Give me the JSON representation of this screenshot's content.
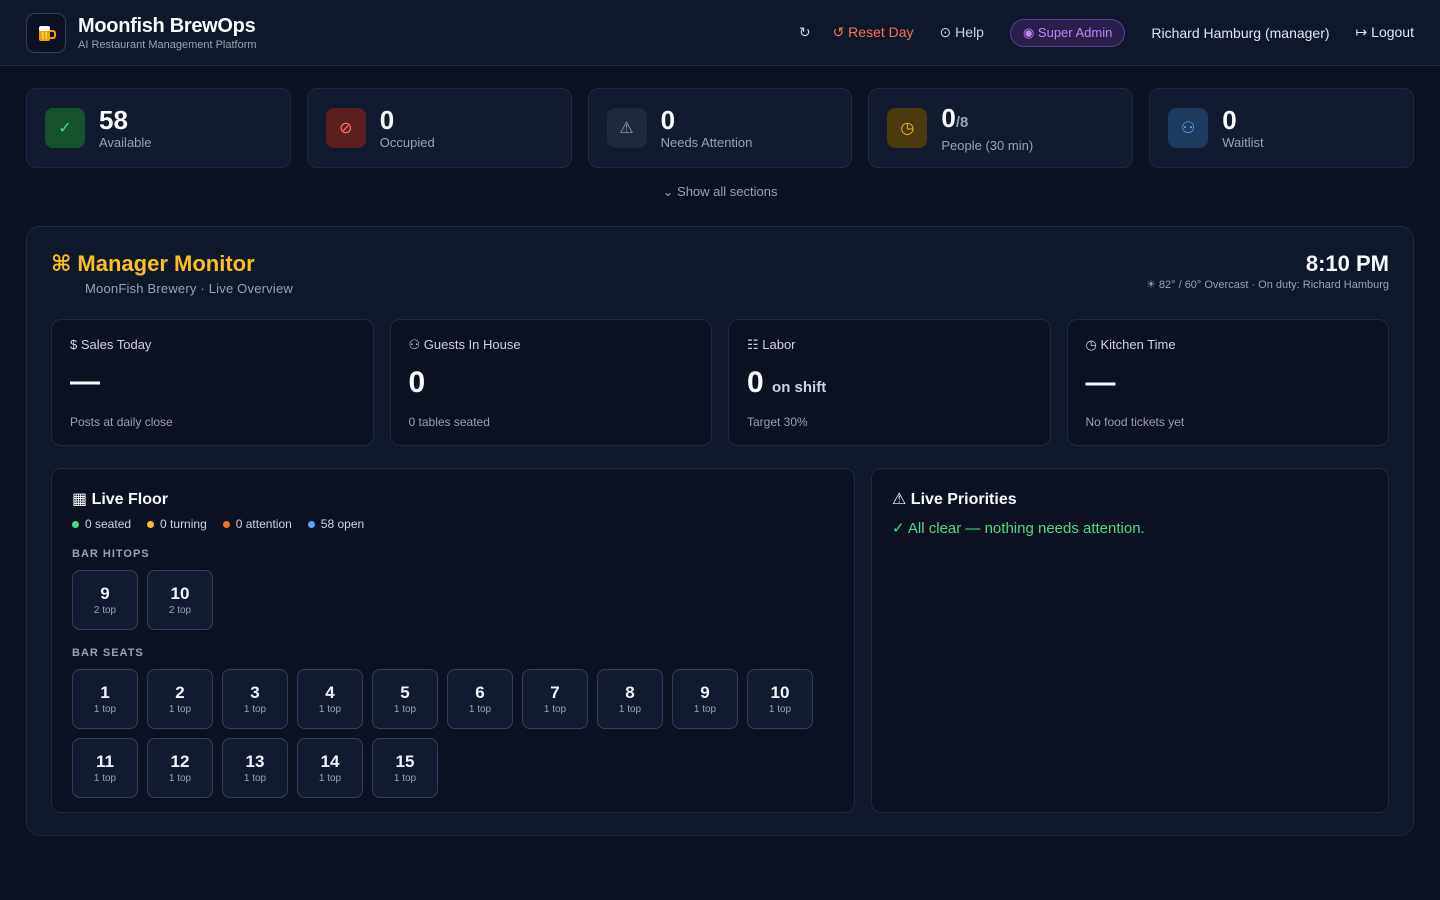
{
  "header": {
    "logo_icon": "beer-mug-icon",
    "title": "Moonfish BrewOps",
    "subtitle": "AI Restaurant Management Platform",
    "refresh_label": "↻",
    "reset_label": "↺ Reset Day",
    "help_label": "⊙ Help",
    "admin_badge": "◉ Super Admin",
    "user_label": "Richard Hamburg (manager)",
    "logout_label": "↦ Logout"
  },
  "stats": [
    {
      "value": "58",
      "suffix": "",
      "label": "Available",
      "icon": "check-icon",
      "glyph": "✓",
      "color": "#4ade80",
      "bg": "#14532d"
    },
    {
      "value": "0",
      "suffix": "",
      "label": "Occupied",
      "icon": "block-icon",
      "glyph": "⊘",
      "color": "#f87171",
      "bg": "#5b1f1f"
    },
    {
      "value": "0",
      "suffix": "",
      "label": "Needs Attention",
      "icon": "warning-icon",
      "glyph": "⚠",
      "color": "#94a3b8",
      "bg": "#1e293b"
    },
    {
      "value": "0",
      "suffix": "/8",
      "label": "People (30 min)",
      "icon": "clock-icon",
      "glyph": "◷",
      "color": "#fbbf24",
      "bg": "#4a3a0f"
    },
    {
      "value": "0",
      "suffix": "",
      "label": "Waitlist",
      "icon": "people-icon",
      "glyph": "⚇",
      "color": "#60a5fa",
      "bg": "#1e3a5f"
    }
  ],
  "show_all": "⌄ Show all sections",
  "monitor": {
    "title_icon": "⌘",
    "title": "Manager Monitor",
    "subtitle": "MoonFish Brewery · Live Overview",
    "time": "8:10 PM",
    "weather": "☀ 82° / 60° Overcast · On duty: Richard Hamburg"
  },
  "kpis": [
    {
      "head": "$ Sales Today",
      "value": "—",
      "small": "",
      "note": "Posts at daily close"
    },
    {
      "head": "⚇ Guests In House",
      "value": "0",
      "small": "",
      "note": "0 tables seated"
    },
    {
      "head": "☷ Labor",
      "value": "0",
      "small": "on shift",
      "note": "Target 30%"
    },
    {
      "head": "◷ Kitchen Time",
      "value": "—",
      "small": "",
      "note": "No food tickets yet"
    }
  ],
  "floor": {
    "title": "▦ Live Floor",
    "legend": [
      {
        "label": "0 seated",
        "color": "#4ade80"
      },
      {
        "label": "0 turning",
        "color": "#fbbf24"
      },
      {
        "label": "0 attention",
        "color": "#f97316"
      },
      {
        "label": "58 open",
        "color": "#60a5fa"
      }
    ],
    "sections": [
      {
        "label": "BAR HITOPS",
        "tables": [
          {
            "num": "9",
            "cap": "2 top"
          },
          {
            "num": "10",
            "cap": "2 top"
          }
        ]
      },
      {
        "label": "BAR SEATS",
        "tables": [
          {
            "num": "1",
            "cap": "1 top"
          },
          {
            "num": "2",
            "cap": "1 top"
          },
          {
            "num": "3",
            "cap": "1 top"
          },
          {
            "num": "4",
            "cap": "1 top"
          },
          {
            "num": "5",
            "cap": "1 top"
          },
          {
            "num": "6",
            "cap": "1 top"
          },
          {
            "num": "7",
            "cap": "1 top"
          },
          {
            "num": "8",
            "cap": "1 top"
          },
          {
            "num": "9",
            "cap": "1 top"
          },
          {
            "num": "10",
            "cap": "1 top"
          },
          {
            "num": "11",
            "cap": "1 top"
          },
          {
            "num": "12",
            "cap": "1 top"
          },
          {
            "num": "13",
            "cap": "1 top"
          },
          {
            "num": "14",
            "cap": "1 top"
          },
          {
            "num": "15",
            "cap": "1 top"
          }
        ]
      }
    ]
  },
  "priorities": {
    "title": "⚠ Live Priorities",
    "message": "✓ All clear — nothing needs attention."
  }
}
